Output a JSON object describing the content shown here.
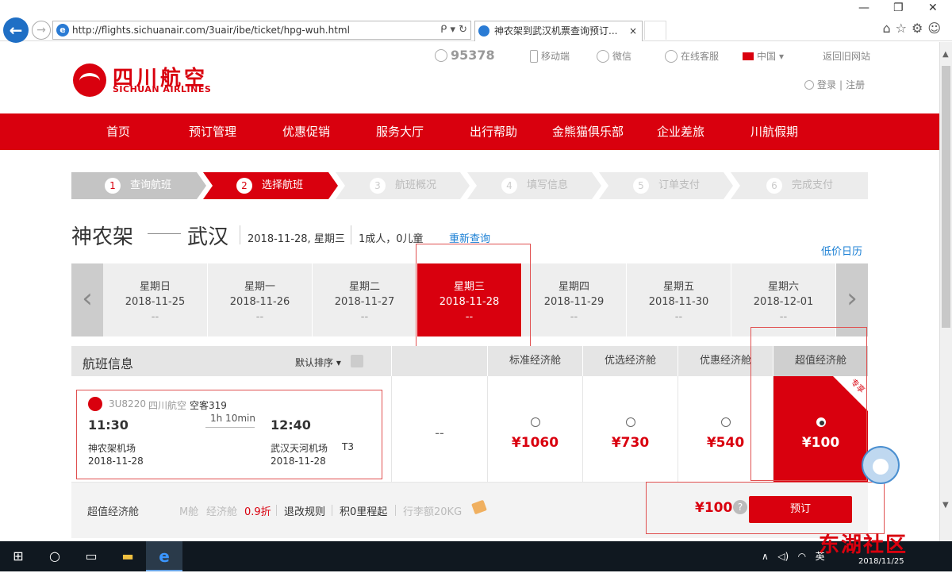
{
  "browser": {
    "url": "http://flights.sichuanair.com/3uair/ibe/ticket/hpg-wuh.html",
    "tab_title": "神农架到武汉机票查询预订...",
    "tab_close": "×",
    "addr_tools": "ᑭ ▾ ↻",
    "win_controls": {
      "min": "—",
      "max": "❐",
      "close": "✕"
    },
    "icons": "⌂☆⚙☺"
  },
  "header": {
    "logo_cn": "四川航空",
    "logo_en": "SICHUAN AIRLINES",
    "hotline": "95378",
    "mobile": "移动端",
    "wechat": "微信",
    "online_service": "在线客服",
    "region": "中国",
    "old_site": "返回旧网站",
    "login": "登录",
    "register": "注册",
    "auth_sep": "|"
  },
  "nav": {
    "items": [
      "首页",
      "预订管理",
      "优惠促销",
      "服务大厅",
      "出行帮助",
      "金熊猫俱乐部",
      "企业差旅",
      "川航假期"
    ]
  },
  "steps": [
    {
      "num": "1",
      "label": "查询航班"
    },
    {
      "num": "2",
      "label": "选择航班"
    },
    {
      "num": "3",
      "label": "航班概况"
    },
    {
      "num": "4",
      "label": "填写信息"
    },
    {
      "num": "5",
      "label": "订单支付"
    },
    {
      "num": "6",
      "label": "完成支付"
    }
  ],
  "route": {
    "from": "神农架",
    "to": "武汉",
    "date": "2018-11-28, 星期三",
    "pax": "1成人，0儿童",
    "requery": "重新查询",
    "low_price_calendar": "低价日历"
  },
  "dates": {
    "prev": "‹",
    "next": "›",
    "days": [
      {
        "weekday": "星期日",
        "date": "2018-11-25",
        "price": "--"
      },
      {
        "weekday": "星期一",
        "date": "2018-11-26",
        "price": "--"
      },
      {
        "weekday": "星期二",
        "date": "2018-11-27",
        "price": "--"
      },
      {
        "weekday": "星期三",
        "date": "2018-11-28",
        "price": "--"
      },
      {
        "weekday": "星期四",
        "date": "2018-11-29",
        "price": "--"
      },
      {
        "weekday": "星期五",
        "date": "2018-11-30",
        "price": "--"
      },
      {
        "weekday": "星期六",
        "date": "2018-12-01",
        "price": "--"
      }
    ]
  },
  "table": {
    "title": "航班信息",
    "sort": "默认排序 ▾",
    "columns": [
      "标准经济舱",
      "优选经济舱",
      "优惠经济舱",
      "超值经济舱"
    ]
  },
  "flight": {
    "number": "3U8220",
    "airline": "四川航空",
    "aircraft": "空客319",
    "dep_time": "11:30",
    "arr_time": "12:40",
    "duration": "1h 10min",
    "dep_airport": "神农架机场",
    "arr_airport": "武汉天河机场",
    "terminal": "T3",
    "dep_date": "2018-11-28",
    "arr_date": "2018-11-28",
    "first_col": "--",
    "prices": [
      "¥1060",
      "¥730",
      "¥540",
      "¥100"
    ],
    "exclusive": "专享"
  },
  "fare_bar": {
    "name": "超值经济舱",
    "cabin": "M舱",
    "cabin_class": "经济舱",
    "discount": "0.9折",
    "refund_rules": "退改规则",
    "mileage": "积0里程起",
    "baggage": "行李额20KG",
    "price": "¥100",
    "help": "?",
    "book": "预订"
  },
  "taskbar": {
    "tray_lang": "英",
    "clock": "2018/11/25",
    "watermark": "东湖社区"
  },
  "colors": {
    "brand": "#d9000e",
    "link": "#1a7fd4"
  }
}
